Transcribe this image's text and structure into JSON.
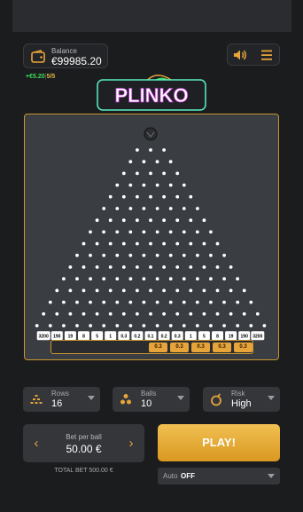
{
  "header": {
    "balance_label": "Balance",
    "balance_value": "€99985.20",
    "last_win": "+€5.20",
    "win_count": "5/5"
  },
  "logo": {
    "text": "PLINKO"
  },
  "board": {
    "rows": 16,
    "multipliers": [
      "3200",
      "190",
      "19",
      "8",
      "5",
      "1",
      "0.3",
      "0.2",
      "0.1",
      "0.2",
      "0.3",
      "1",
      "5",
      "8",
      "19",
      "190",
      "3200"
    ]
  },
  "history": [
    "0.3",
    "0.3",
    "0.3",
    "0.3",
    "0.3"
  ],
  "settings": {
    "rows_label": "Rows",
    "rows_value": "16",
    "balls_label": "Balls",
    "balls_value": "10",
    "risk_label": "Risk",
    "risk_value": "High"
  },
  "bet": {
    "label": "Bet per ball",
    "value": "50.00 €",
    "decrease_icon": "‹",
    "increase_icon": "›",
    "total": "TOTAL BET 500.00 €"
  },
  "play_button": "PLAY!",
  "auto": {
    "label": "Auto",
    "value": "OFF"
  },
  "colors": {
    "accent": "#e7a43a",
    "board_border": "#c9962e",
    "win": "#3ddc5a"
  }
}
